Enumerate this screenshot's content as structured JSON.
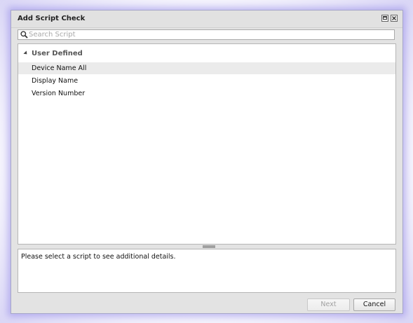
{
  "window": {
    "title": "Add Script Check"
  },
  "search": {
    "placeholder": "Search Script",
    "value": ""
  },
  "list": {
    "group_label": "User Defined",
    "items": [
      {
        "label": "Device Name All",
        "selected": true
      },
      {
        "label": "Display Name",
        "selected": false
      },
      {
        "label": "Version Number",
        "selected": false
      }
    ]
  },
  "details": {
    "text": "Please select a script to see additional details."
  },
  "footer": {
    "next_label": "Next",
    "next_enabled": false,
    "cancel_label": "Cancel"
  },
  "icons": {
    "search": "search-icon",
    "maximize": "maximize-icon",
    "close": "close-icon",
    "collapse": "triangle-down-icon"
  },
  "colors": {
    "selected_row": "#ebebeb",
    "dialog_background": "#e3e3e3",
    "glow": "#8c82e6"
  }
}
